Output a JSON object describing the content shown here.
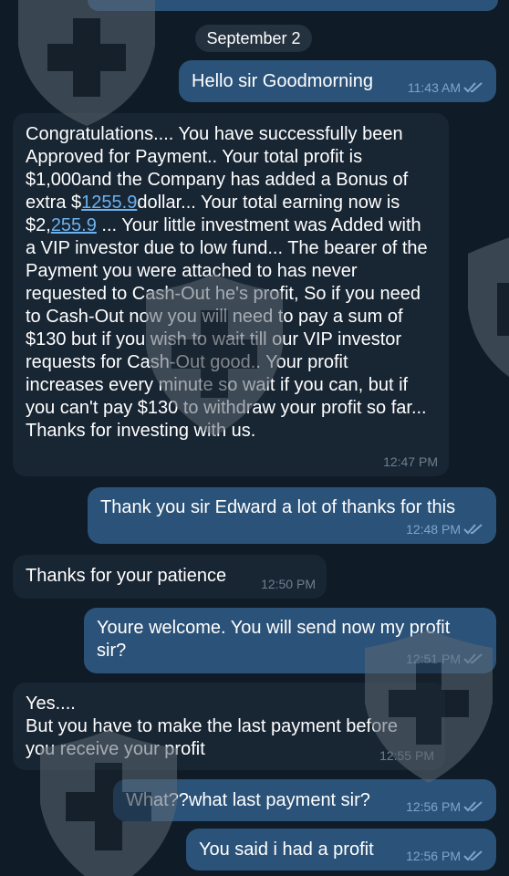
{
  "date_divider": "September 2",
  "messages": [
    {
      "direction": "out",
      "text": "Hello sir Goodmorning",
      "time": "11:43 AM",
      "read": true
    },
    {
      "direction": "in",
      "text_parts": {
        "p1": "Congratulations.... You have successfully been Approved for Payment.. Your total profit is $1,000and the Company has added a Bonus of extra $",
        "link1": "1255.9",
        "p2": "dollar... Your total earning now is $2,",
        "link2": "255.9",
        "p3": " ... Your little investment was Added with a VIP investor due to low fund... The bearer of the Payment you were attached to has never requested to Cash-Out he's profit, So if you need to Cash-Out now you will need to pay a sum of $130 but if you wish to wait till our VIP investor requests for Cash-Out good.. Your profit increases every minute so wait if you can, but if you can't pay $130 to withdraw your profit so far... Thanks for investing with us."
      },
      "time": "12:47 PM"
    },
    {
      "direction": "out",
      "text": "Thank you sir Edward a lot of thanks for this",
      "time": "12:48 PM",
      "read": true
    },
    {
      "direction": "in",
      "text": "Thanks for your patience",
      "time": "12:50 PM"
    },
    {
      "direction": "out",
      "text": "Youre welcome. You will send now my profit sir?",
      "time": "12:51 PM",
      "read": true
    },
    {
      "direction": "in",
      "text": "Yes....\nBut you have to make the last payment before you receive your profit",
      "time": "12:55 PM"
    },
    {
      "direction": "out",
      "text": "What??what last payment sir?",
      "time": "12:56 PM",
      "read": true
    },
    {
      "direction": "out",
      "text": "You said i had a profit",
      "time": "12:56 PM",
      "read": true
    }
  ],
  "colors": {
    "background": "#0f1b26",
    "outgoing_bubble": "#2b5278",
    "incoming_bubble": "#182533",
    "link": "#6ab2f2",
    "read_ticks": "#7ea6cc"
  },
  "icons": {
    "read_receipt": "double-check-icon",
    "watermark": "shield-cross-icon"
  }
}
